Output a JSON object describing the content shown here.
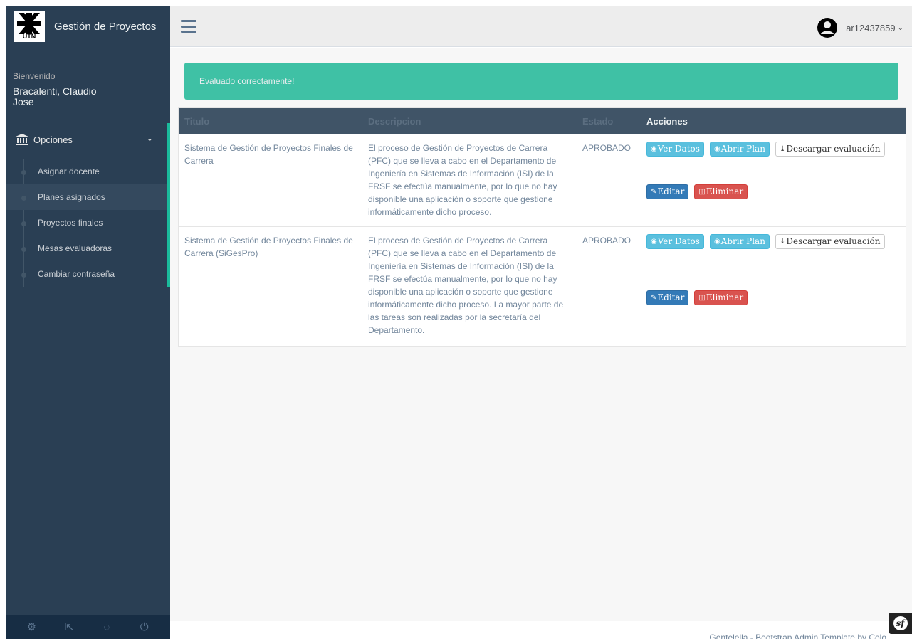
{
  "brand": {
    "title": "Gestión de Proyectos",
    "logo_text": "UTN"
  },
  "profile": {
    "welcome": "Bienvenido",
    "name": "Bracalenti, Claudio Jose"
  },
  "sidebar": {
    "section_label": "Opciones",
    "items": [
      {
        "label": "Asignar docente"
      },
      {
        "label": "Planes asignados"
      },
      {
        "label": "Proyectos finales"
      },
      {
        "label": "Mesas evaluadoras"
      },
      {
        "label": "Cambiar contraseña"
      }
    ],
    "active_index": 1,
    "footer_icons": [
      "settings-icon",
      "fullscreen-icon",
      "lock-icon",
      "power-icon"
    ]
  },
  "topnav": {
    "username": "ar12437859"
  },
  "alert": {
    "message": "Evaluado correctamente!",
    "color": "#26B99A"
  },
  "table": {
    "headers": {
      "titulo": "Titulo",
      "descripcion": "Descripcion",
      "estado": "Estado",
      "acciones": "Acciones"
    },
    "rows": [
      {
        "titulo": "Sistema de Gestión de Proyectos Finales de Carrera",
        "descripcion": "El proceso de Gestión de Proyectos de Carrera (PFC) que se lleva a cabo en el Departamento de Ingeniería en Sistemas de Información (ISI) de la FRSF se efectúa manualmente, por lo que no hay disponible una aplicación o soporte que gestione informáticamente dicho proceso.",
        "estado": "APROBADO"
      },
      {
        "titulo": "Sistema de Gestión de Proyectos Finales de Carrera (SiGesPro)",
        "descripcion": "El proceso de Gestión de Proyectos de Carrera (PFC) que se lleva a cabo en el Departamento de Ingeniería en Sistemas de Información (ISI) de la FRSF se efectúa manualmente, por lo que no hay disponible una aplicación o soporte que gestione informáticamente dicho proceso. La mayor parte de las tareas son realizadas por la secretaría del Departamento.",
        "estado": "APROBADO"
      }
    ],
    "actions": {
      "ver_datos": "Ver Datos",
      "abrir_plan": "Abrir Plan",
      "descargar": "Descargar evaluación",
      "editar": "Editar",
      "eliminar": "Eliminar"
    }
  },
  "footer": {
    "text": "Gentelella - Bootstrap Admin Template by Colo"
  },
  "colors": {
    "sidebar": "#2A3F54",
    "accent": "#1ABB9C",
    "info": "#5BC0DE",
    "primary": "#337AB7",
    "danger": "#D9534F"
  }
}
